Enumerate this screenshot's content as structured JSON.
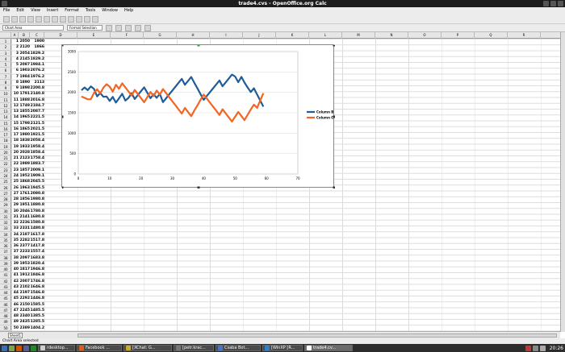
{
  "window": {
    "title": "trade4.cvs - OpenOffice.org Calc"
  },
  "menu": [
    "File",
    "Edit",
    "View",
    "Insert",
    "Format",
    "Tools",
    "Window",
    "Help"
  ],
  "formatbar": {
    "name_box": "Chart Area",
    "style_box": "Format Selection"
  },
  "column_headers": [
    "A",
    "B",
    "C",
    "D",
    "E",
    "F",
    "G",
    "H",
    "I",
    "J",
    "K",
    "L",
    "M",
    "N",
    "O",
    "P",
    "Q",
    "R",
    "S"
  ],
  "rows": [
    [
      "1",
      "2050",
      "1900"
    ],
    [
      "2",
      "2120",
      "1866"
    ],
    [
      "3",
      "2054",
      "1829.2"
    ],
    [
      "4",
      "2145",
      "1829.2"
    ],
    [
      "5",
      "2087",
      "1984.1"
    ],
    [
      "6",
      "1903",
      "2076.2"
    ],
    [
      "7",
      "1984",
      "1976.2"
    ],
    [
      "8",
      "1890",
      "2113"
    ],
    [
      "9",
      "1898",
      "2200.8"
    ],
    [
      "10",
      "1791",
      "2140.8"
    ],
    [
      "11",
      "1888",
      "2016.8"
    ],
    [
      "12",
      "1749",
      "2184.7"
    ],
    [
      "13",
      "1855",
      "2087.7"
    ],
    [
      "14",
      "1965",
      "2221.5"
    ],
    [
      "15",
      "1798",
      "2121.5"
    ],
    [
      "16",
      "1865",
      "2021.5"
    ],
    [
      "17",
      "1980",
      "1921.5"
    ],
    [
      "18",
      "1838",
      "2058.4"
    ],
    [
      "19",
      "1933",
      "1958.4"
    ],
    [
      "20",
      "2028",
      "1858.4"
    ],
    [
      "21",
      "2123",
      "1758.4"
    ],
    [
      "22",
      "1989",
      "1883.7"
    ],
    [
      "23",
      "1857",
      "2009.1"
    ],
    [
      "24",
      "1952",
      "1909.1"
    ],
    [
      "25",
      "1868",
      "2045.5"
    ],
    [
      "26",
      "1963",
      "1945.5"
    ],
    [
      "27",
      "1761",
      "2080.8"
    ],
    [
      "28",
      "1856",
      "1980.8"
    ],
    [
      "29",
      "1951",
      "1880.8"
    ],
    [
      "30",
      "2046",
      "1780.8"
    ],
    [
      "31",
      "2141",
      "1680.8"
    ],
    [
      "32",
      "2236",
      "1580.8"
    ],
    [
      "33",
      "2331",
      "1480.8"
    ],
    [
      "34",
      "2187",
      "1617.8"
    ],
    [
      "35",
      "2282",
      "1517.8"
    ],
    [
      "36",
      "2377",
      "1417.8"
    ],
    [
      "37",
      "2233",
      "1557.4"
    ],
    [
      "38",
      "2097",
      "1683.8"
    ],
    [
      "39",
      "1953",
      "1820.4"
    ],
    [
      "40",
      "1817",
      "1946.8"
    ],
    [
      "41",
      "1912",
      "1846.8"
    ],
    [
      "42",
      "2007",
      "1746.8"
    ],
    [
      "43",
      "2102",
      "1646.8"
    ],
    [
      "44",
      "2197",
      "1546.8"
    ],
    [
      "45",
      "2292",
      "1446.8"
    ],
    [
      "46",
      "2150",
      "1585.5"
    ],
    [
      "47",
      "2245",
      "1485.5"
    ],
    [
      "48",
      "2340",
      "1385.5"
    ],
    [
      "49",
      "2435",
      "1285.5"
    ],
    [
      "50",
      "2389",
      "1404.2"
    ]
  ],
  "chart_data": {
    "type": "line",
    "x": [
      1,
      2,
      3,
      4,
      5,
      6,
      7,
      8,
      9,
      10,
      11,
      12,
      13,
      14,
      15,
      16,
      17,
      18,
      19,
      20,
      21,
      22,
      23,
      24,
      25,
      26,
      27,
      28,
      29,
      30,
      31,
      32,
      33,
      34,
      35,
      36,
      37,
      38,
      39,
      40,
      41,
      42,
      43,
      44,
      45,
      46,
      47,
      48,
      49,
      50,
      51,
      52,
      53,
      54,
      55,
      56,
      57,
      58,
      59
    ],
    "series": [
      {
        "name": "Column B",
        "color": "#1f5c99",
        "values": [
          2050,
          2120,
          2054,
          2145,
          2087,
          1903,
          1984,
          1890,
          1898,
          1791,
          1888,
          1749,
          1855,
          1965,
          1798,
          1865,
          1980,
          1838,
          1933,
          2028,
          2123,
          1989,
          1857,
          1952,
          1868,
          1963,
          1761,
          1856,
          1951,
          2046,
          2141,
          2236,
          2331,
          2187,
          2282,
          2377,
          2233,
          2097,
          1953,
          1817,
          1912,
          2007,
          2102,
          2197,
          2292,
          2150,
          2245,
          2340,
          2435,
          2389,
          2250,
          2380,
          2240,
          2120,
          2010,
          2100,
          1950,
          1800,
          1650
        ]
      },
      {
        "name": "Column C",
        "color": "#f26522",
        "values": [
          1900,
          1866,
          1829.2,
          1829.2,
          1984.1,
          2076.2,
          1976.2,
          2113,
          2200.8,
          2140.8,
          2016.8,
          2184.7,
          2087.7,
          2221.5,
          2121.5,
          2021.5,
          1921.5,
          2058.4,
          1958.4,
          1858.4,
          1758.4,
          1883.7,
          2009.1,
          1909.1,
          2045.5,
          1945.5,
          2080.8,
          1980.8,
          1880.8,
          1780.8,
          1680.8,
          1580.8,
          1480.8,
          1617.8,
          1517.8,
          1417.8,
          1557.4,
          1683.8,
          1820.4,
          1946.8,
          1846.8,
          1746.8,
          1646.8,
          1546.8,
          1446.8,
          1585.5,
          1485.5,
          1385.5,
          1285.5,
          1404.2,
          1520,
          1420,
          1320,
          1450,
          1580,
          1700,
          1620,
          1800,
          1980
        ]
      }
    ],
    "xlim": [
      0,
      70
    ],
    "ylim": [
      0,
      3000
    ],
    "xticks": [
      "0",
      "10",
      "20",
      "30",
      "40",
      "50",
      "60",
      "70"
    ],
    "yticks": [
      "0",
      "500",
      "1000",
      "1500",
      "2000",
      "2500",
      "3000"
    ],
    "grid": true,
    "legend": "right"
  },
  "sheet_tab": "Sheet1",
  "status": "Chart Area selected",
  "taskbar": {
    "items": [
      "rdesktop...",
      "Facebook ...",
      "[XChat: G...",
      "[petr.krac...",
      "Csaba Bot...",
      "[WinXP [R...",
      "trade4.cv..."
    ],
    "clock": "20:26"
  }
}
